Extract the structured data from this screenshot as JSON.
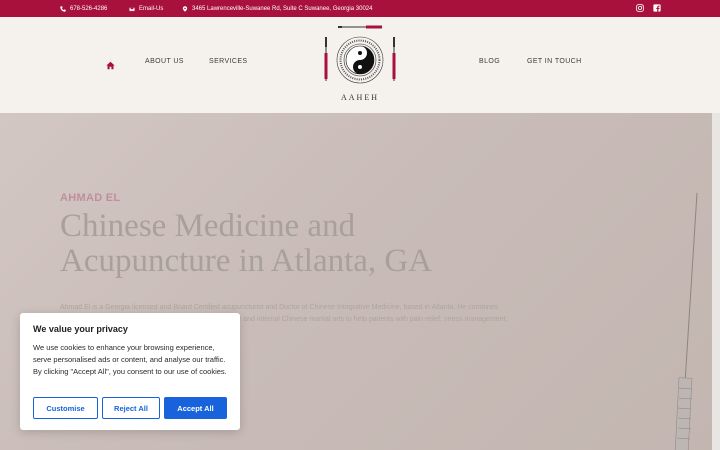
{
  "topbar": {
    "phone": "678-526-4286",
    "email": "Email-Us",
    "address": "3465 Lawrenceville-Suwanee Rd, Suite C Suwanee, Georgia 30024",
    "icons": [
      "phone-icon",
      "mail-icon",
      "map-pin-icon",
      "instagram-icon",
      "facebook-icon"
    ]
  },
  "nav": {
    "about": "ABOUT US",
    "services": "SERVICES",
    "blog": "BLOG",
    "contact": "GET IN TOUCH"
  },
  "logo": {
    "text": "AAHEH"
  },
  "hero": {
    "eyebrow": "AHMAD EL",
    "title_line1": "Chinese Medicine and",
    "title_line2": "Acupuncture in Atlanta, GA",
    "body": "Ahmad El is a Georgia licensed and Board Certified acupuncturist and Doctor of Chinese Integrative Medicine, based in Atlanta. He combines years of clinical experience in traditional Chinese medicine and internal Chinese martial arts to help patients with pain relief, stress management, and overall wellness."
  },
  "cookie": {
    "title": "We value your privacy",
    "text": "We use cookies to enhance your browsing experience, serve personalised ads or content, and analyse our traffic. By clicking \"Accept All\", you consent to our use of cookies.",
    "customise": "Customise",
    "reject": "Reject All",
    "accept": "Accept All"
  },
  "colors": {
    "brand": "#a8113b",
    "accent_button": "#1863dc"
  }
}
